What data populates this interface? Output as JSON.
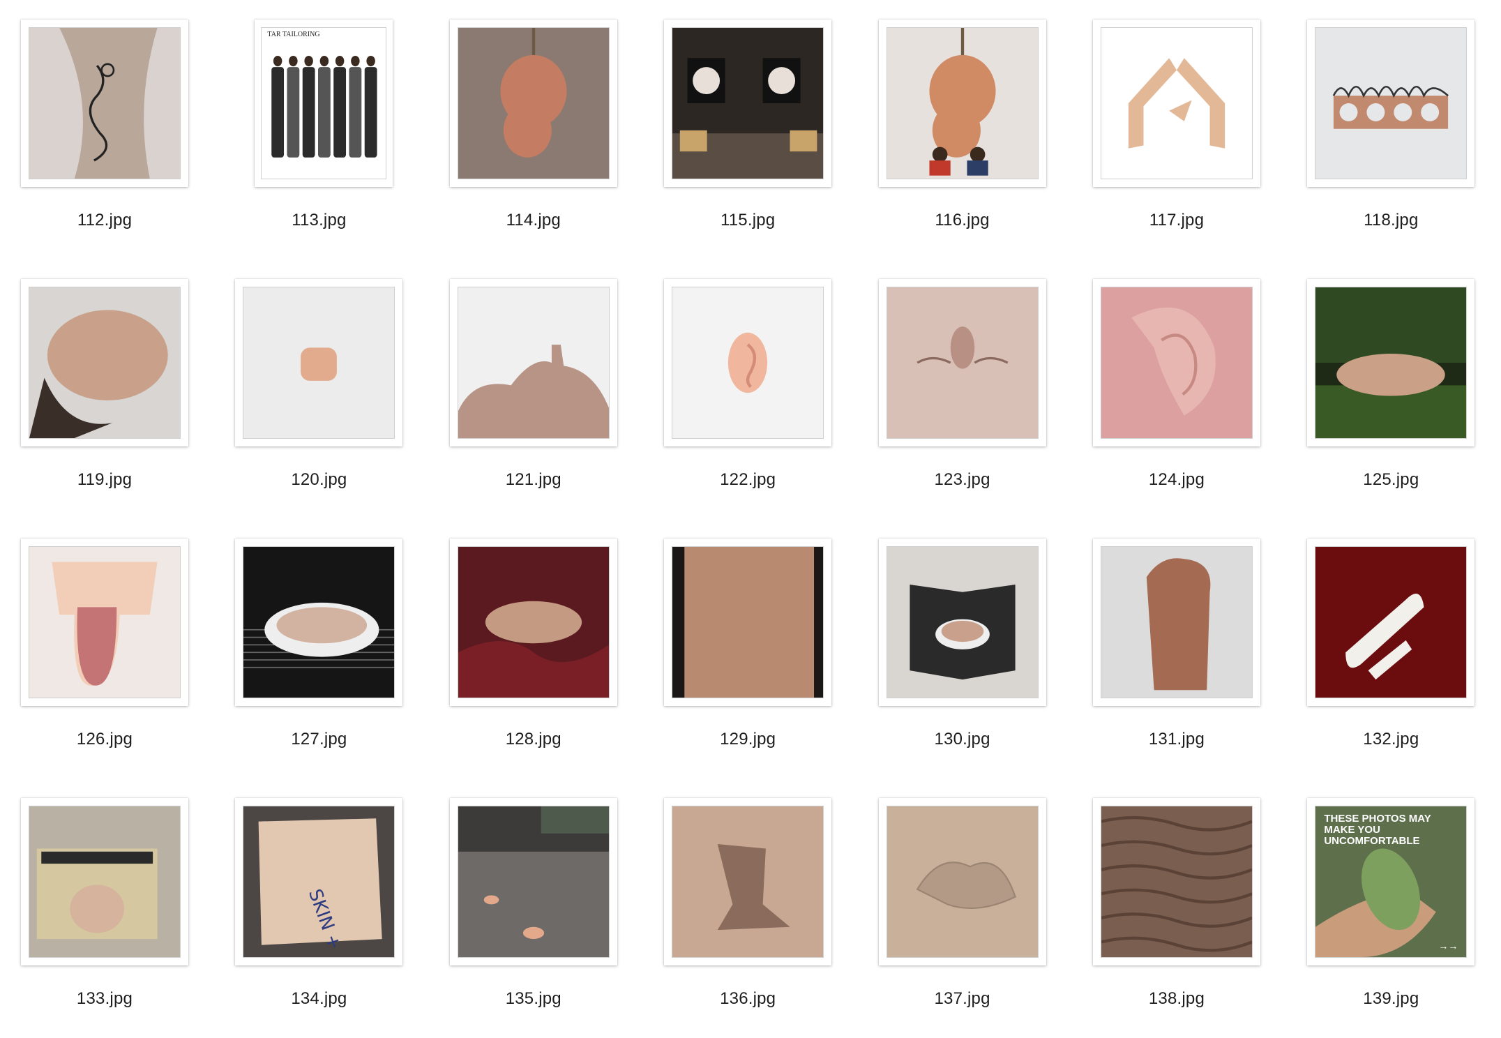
{
  "files": [
    {
      "name": "112.jpg",
      "thumb": "tattoo-on-leg",
      "bg": "#d9d2cf",
      "fg": "#b9a79a"
    },
    {
      "name": "113.jpg",
      "thumb": "fashion-group",
      "bg": "#ffffff",
      "fg": "#2a2a2a",
      "brand": "TAR TAILORING"
    },
    {
      "name": "114.jpg",
      "thumb": "hanging-sculpture",
      "bg": "#8a7a72",
      "fg": "#c47c62"
    },
    {
      "name": "115.jpg",
      "thumb": "gallery-room",
      "bg": "#2c2723",
      "fg": "#d8cfc6"
    },
    {
      "name": "116.jpg",
      "thumb": "hanging-sculpture-kids",
      "bg": "#e7e1dd",
      "fg": "#d08a64"
    },
    {
      "name": "117.jpg",
      "thumb": "hands-house",
      "bg": "#ffffff",
      "fg": "#e3b897"
    },
    {
      "name": "118.jpg",
      "thumb": "brick-hair",
      "bg": "#e6e7e9",
      "fg": "#c18a6f"
    },
    {
      "name": "119.jpg",
      "thumb": "silicone-face-fur",
      "bg": "#d8d5d2",
      "fg": "#c9a08a"
    },
    {
      "name": "120.jpg",
      "thumb": "small-tooth",
      "bg": "#ececec",
      "fg": "#e2ab8d"
    },
    {
      "name": "121.jpg",
      "thumb": "flat-skin-form",
      "bg": "#f0f0f0",
      "fg": "#b79486"
    },
    {
      "name": "122.jpg",
      "thumb": "ear-object",
      "bg": "#f3f3f3",
      "fg": "#f0b69e"
    },
    {
      "name": "123.jpg",
      "thumb": "skin-closeup-face",
      "bg": "#d9c0b6",
      "fg": "#c6a89b"
    },
    {
      "name": "124.jpg",
      "thumb": "ear-closeup",
      "bg": "#dca0a0",
      "fg": "#e7b6b0"
    },
    {
      "name": "125.jpg",
      "thumb": "moss-skin",
      "bg": "#1e2a16",
      "fg": "#caa186"
    },
    {
      "name": "126.jpg",
      "thumb": "tongue",
      "bg": "#efe8e4",
      "fg": "#c47475"
    },
    {
      "name": "127.jpg",
      "thumb": "oven-dish",
      "bg": "#151515",
      "fg": "#d2b2a1"
    },
    {
      "name": "128.jpg",
      "thumb": "red-drape",
      "bg": "#5a1a1f",
      "fg": "#c59a82"
    },
    {
      "name": "129.jpg",
      "thumb": "skin-texture",
      "bg": "#1b1716",
      "fg": "#b88b70"
    },
    {
      "name": "130.jpg",
      "thumb": "open-book",
      "bg": "#d9d6d2",
      "fg": "#2a2a2a"
    },
    {
      "name": "131.jpg",
      "thumb": "hand-object",
      "bg": "#dcdcdc",
      "fg": "#a46a52"
    },
    {
      "name": "132.jpg",
      "thumb": "white-bone",
      "bg": "#6b0d0f",
      "fg": "#f2f0ea"
    },
    {
      "name": "133.jpg",
      "thumb": "amp-skin",
      "bg": "#b9b1a4",
      "fg": "#d6b39c"
    },
    {
      "name": "134.jpg",
      "thumb": "skin-parchment",
      "bg": "#4c4744",
      "fg": "#e2c7b1",
      "text": "SKIN +"
    },
    {
      "name": "135.jpg",
      "thumb": "grave-ears",
      "bg": "#6d6a67",
      "fg": "#e4a88a"
    },
    {
      "name": "136.jpg",
      "thumb": "draped-skin",
      "bg": "#c9a893",
      "fg": "#8a6b5c"
    },
    {
      "name": "137.jpg",
      "thumb": "embossed-skin",
      "bg": "#c8b09a",
      "fg": "#b29a86"
    },
    {
      "name": "138.jpg",
      "thumb": "wrinkled-skin",
      "bg": "#7a5e50",
      "fg": "#a48472"
    },
    {
      "name": "139.jpg",
      "thumb": "hand-leaf",
      "bg": "#5e6f4c",
      "fg": "#c99c7b",
      "text": "THESE PHOTOS MAY MAKE YOU UNCOMFORTABLE",
      "arrow": "→→"
    }
  ]
}
